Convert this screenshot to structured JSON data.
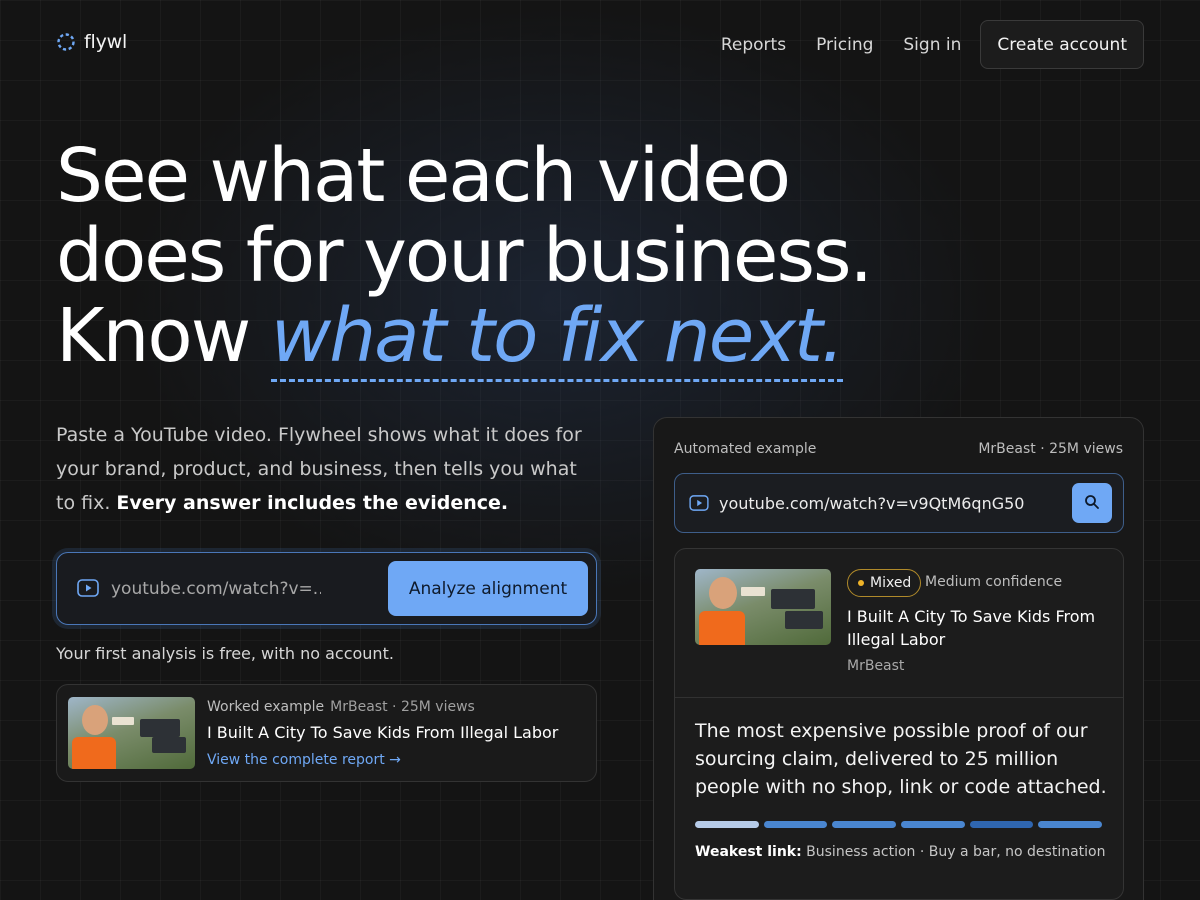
{
  "brand": {
    "name": "flywl"
  },
  "nav": {
    "links": [
      "Reports",
      "Pricing",
      "Sign in"
    ],
    "cta": "Create account"
  },
  "hero": {
    "line1": "See what each video",
    "line2": "does for your business.",
    "line3_plain": "Know ",
    "line3_accent": "what to fix next."
  },
  "lead": {
    "text": "Paste a YouTube video. Flywheel shows what it does for your brand, product, and business, then tells you what to fix. ",
    "emphasis": "Every answer includes the evidence."
  },
  "analyze": {
    "placeholder": "youtube.com/watch?v=...",
    "button": "Analyze alignment"
  },
  "free_note": "Your first analysis is free, with no account.",
  "worked_example": {
    "label": "Worked example",
    "meta": "MrBeast · 25M views",
    "title": "I Built A City To Save Kids From Illegal Labor",
    "link": "View the complete report →"
  },
  "panel": {
    "label": "Automated example",
    "meta": "MrBeast · 25M views",
    "url": "youtube.com/watch?v=v9QtM6qnG50",
    "result": {
      "badge": "Mixed",
      "confidence": "Medium confidence",
      "title": "I Built A City To Save Kids From Illegal Labor",
      "channel": "MrBeast",
      "summary": "The most expensive possible proof of our sourcing claim, delivered to 25 million people with no shop, link or code attached.",
      "bar_colors": [
        "#b6cbe8",
        "#4a86d0",
        "#4a86d0",
        "#4a86d0",
        "#2f66b0",
        "#4a86d0"
      ],
      "weakest_label": "Weakest link:",
      "weakest_value": " Business action · Buy a bar, no destination"
    }
  },
  "colors": {
    "accent": "#6fa8f5",
    "badge": "#f0b429",
    "background": "#141414"
  }
}
